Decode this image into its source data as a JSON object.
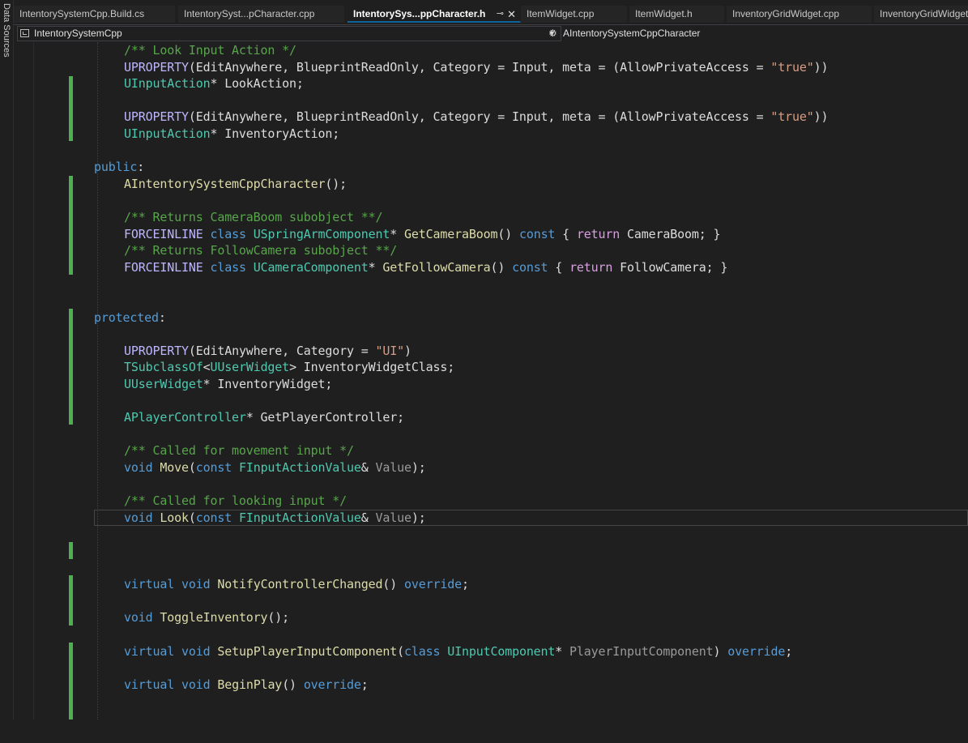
{
  "left_strip": {
    "label": "Data Sources"
  },
  "tabs": [
    {
      "label": "IntentorySystemCpp.Build.cs",
      "active": false
    },
    {
      "label": "IntentorySyst...pCharacter.cpp",
      "active": false
    },
    {
      "label": "IntentorySys...ppCharacter.h",
      "active": true
    },
    {
      "label": "ItemWidget.cpp",
      "active": false
    },
    {
      "label": "ItemWidget.h",
      "active": false
    },
    {
      "label": "InventoryGridWidget.cpp",
      "active": false
    },
    {
      "label": "InventoryGridWidget",
      "active": false
    }
  ],
  "navbar": {
    "project": "IntentorySystemCpp",
    "member": "AIntentorySystemCppCharacter"
  },
  "colors": {
    "keyword": "#569cd6",
    "comment": "#57a64a",
    "macro": "#beb7ff",
    "type": "#4ec9b0",
    "string": "#d69d85",
    "function": "#dcdcaa",
    "parameter": "#9a9a9a",
    "control": "#d8a0df",
    "change_bar": "#4caf50"
  },
  "code_lines": [
    {
      "indent": true,
      "tokens": [
        [
          "c",
          "/** Look Input Action */"
        ]
      ]
    },
    {
      "indent": true,
      "tokens": [
        [
          "m",
          "UPROPERTY"
        ],
        [
          "n",
          "(EditAnywhere, BlueprintReadOnly, Category = Input, meta = (AllowPrivateAccess = "
        ],
        [
          "s",
          "\"true\""
        ],
        [
          "n",
          "))"
        ]
      ]
    },
    {
      "indent": true,
      "tokens": [
        [
          "t",
          "UInputAction"
        ],
        [
          "n",
          "* LookAction;"
        ]
      ]
    },
    {
      "indent": true,
      "tokens": []
    },
    {
      "indent": true,
      "tokens": [
        [
          "m",
          "UPROPERTY"
        ],
        [
          "n",
          "(EditAnywhere, BlueprintReadOnly, Category = Input, meta = (AllowPrivateAccess = "
        ],
        [
          "s",
          "\"true\""
        ],
        [
          "n",
          "))"
        ]
      ]
    },
    {
      "indent": true,
      "tokens": [
        [
          "t",
          "UInputAction"
        ],
        [
          "n",
          "* InventoryAction;"
        ]
      ]
    },
    {
      "indent": false,
      "tokens": []
    },
    {
      "indent": false,
      "tokens": [
        [
          "k",
          "public"
        ],
        [
          "n",
          ":"
        ]
      ]
    },
    {
      "indent": true,
      "tokens": [
        [
          "f",
          "AIntentorySystemCppCharacter"
        ],
        [
          "n",
          "();"
        ]
      ]
    },
    {
      "indent": true,
      "tokens": []
    },
    {
      "indent": true,
      "tokens": [
        [
          "c",
          "/** Returns CameraBoom subobject **/"
        ]
      ]
    },
    {
      "indent": true,
      "tokens": [
        [
          "m",
          "FORCEINLINE"
        ],
        [
          "n",
          " "
        ],
        [
          "k",
          "class"
        ],
        [
          "n",
          " "
        ],
        [
          "t",
          "USpringArmComponent"
        ],
        [
          "n",
          "* "
        ],
        [
          "f",
          "GetCameraBoom"
        ],
        [
          "n",
          "() "
        ],
        [
          "k",
          "const"
        ],
        [
          "n",
          " { "
        ],
        [
          "cf",
          "return"
        ],
        [
          "n",
          " CameraBoom; }"
        ]
      ]
    },
    {
      "indent": true,
      "tokens": [
        [
          "c",
          "/** Returns FollowCamera subobject **/"
        ]
      ]
    },
    {
      "indent": true,
      "tokens": [
        [
          "m",
          "FORCEINLINE"
        ],
        [
          "n",
          " "
        ],
        [
          "k",
          "class"
        ],
        [
          "n",
          " "
        ],
        [
          "t",
          "UCameraComponent"
        ],
        [
          "n",
          "* "
        ],
        [
          "f",
          "GetFollowCamera"
        ],
        [
          "n",
          "() "
        ],
        [
          "k",
          "const"
        ],
        [
          "n",
          " { "
        ],
        [
          "cf",
          "return"
        ],
        [
          "n",
          " FollowCamera; }"
        ]
      ]
    },
    {
      "indent": true,
      "tokens": []
    },
    {
      "indent": false,
      "tokens": []
    },
    {
      "indent": false,
      "tokens": [
        [
          "k",
          "protected"
        ],
        [
          "n",
          ":"
        ]
      ]
    },
    {
      "indent": true,
      "tokens": []
    },
    {
      "indent": true,
      "tokens": [
        [
          "m",
          "UPROPERTY"
        ],
        [
          "n",
          "(EditAnywhere, Category = "
        ],
        [
          "s",
          "\"UI\""
        ],
        [
          "n",
          ")"
        ]
      ]
    },
    {
      "indent": true,
      "tokens": [
        [
          "t",
          "TSubclassOf"
        ],
        [
          "n",
          "<"
        ],
        [
          "t",
          "UUserWidget"
        ],
        [
          "n",
          "> InventoryWidgetClass;"
        ]
      ]
    },
    {
      "indent": true,
      "tokens": [
        [
          "t",
          "UUserWidget"
        ],
        [
          "n",
          "* InventoryWidget;"
        ]
      ]
    },
    {
      "indent": true,
      "tokens": []
    },
    {
      "indent": true,
      "tokens": [
        [
          "t",
          "APlayerController"
        ],
        [
          "n",
          "* GetPlayerController;"
        ]
      ]
    },
    {
      "indent": true,
      "tokens": []
    },
    {
      "indent": true,
      "tokens": [
        [
          "c",
          "/** Called for movement input */"
        ]
      ]
    },
    {
      "indent": true,
      "tokens": [
        [
          "k",
          "void"
        ],
        [
          "n",
          " "
        ],
        [
          "f",
          "Move"
        ],
        [
          "n",
          "("
        ],
        [
          "k",
          "const"
        ],
        [
          "n",
          " "
        ],
        [
          "t",
          "FInputActionValue"
        ],
        [
          "n",
          "& "
        ],
        [
          "p",
          "Value"
        ],
        [
          "n",
          ");"
        ]
      ]
    },
    {
      "indent": true,
      "tokens": []
    },
    {
      "indent": true,
      "tokens": [
        [
          "c",
          "/** Called for looking input */"
        ]
      ]
    },
    {
      "indent": true,
      "current": true,
      "tokens": [
        [
          "k",
          "void"
        ],
        [
          "n",
          " "
        ],
        [
          "f",
          "Look"
        ],
        [
          "n",
          "("
        ],
        [
          "k",
          "const"
        ],
        [
          "n",
          " "
        ],
        [
          "t",
          "FInputActionValue"
        ],
        [
          "n",
          "& "
        ],
        [
          "p",
          "Value"
        ],
        [
          "n",
          ");"
        ]
      ]
    },
    {
      "indent": true,
      "tokens": []
    },
    {
      "indent": true,
      "tokens": []
    },
    {
      "indent": true,
      "tokens": []
    },
    {
      "indent": true,
      "tokens": [
        [
          "k",
          "virtual"
        ],
        [
          "n",
          " "
        ],
        [
          "k",
          "void"
        ],
        [
          "n",
          " "
        ],
        [
          "f",
          "NotifyControllerChanged"
        ],
        [
          "n",
          "() "
        ],
        [
          "k",
          "override"
        ],
        [
          "n",
          ";"
        ]
      ]
    },
    {
      "indent": true,
      "tokens": []
    },
    {
      "indent": true,
      "tokens": [
        [
          "k",
          "void"
        ],
        [
          "n",
          " "
        ],
        [
          "f",
          "ToggleInventory"
        ],
        [
          "n",
          "();"
        ]
      ]
    },
    {
      "indent": true,
      "tokens": []
    },
    {
      "indent": true,
      "tokens": [
        [
          "k",
          "virtual"
        ],
        [
          "n",
          " "
        ],
        [
          "k",
          "void"
        ],
        [
          "n",
          " "
        ],
        [
          "f",
          "SetupPlayerInputComponent"
        ],
        [
          "n",
          "("
        ],
        [
          "k",
          "class"
        ],
        [
          "n",
          " "
        ],
        [
          "t",
          "UInputComponent"
        ],
        [
          "n",
          "* "
        ],
        [
          "p",
          "PlayerInputComponent"
        ],
        [
          "n",
          ") "
        ],
        [
          "k",
          "override"
        ],
        [
          "n",
          ";"
        ]
      ]
    },
    {
      "indent": true,
      "tokens": []
    },
    {
      "indent": true,
      "tokens": [
        [
          "k",
          "virtual"
        ],
        [
          "n",
          " "
        ],
        [
          "k",
          "void"
        ],
        [
          "n",
          " "
        ],
        [
          "f",
          "BeginPlay"
        ],
        [
          "n",
          "() "
        ],
        [
          "k",
          "override"
        ],
        [
          "n",
          ";"
        ]
      ]
    },
    {
      "indent": true,
      "tokens": []
    },
    {
      "indent": true,
      "tokens": []
    },
    {
      "indent": true,
      "tokens": []
    }
  ]
}
